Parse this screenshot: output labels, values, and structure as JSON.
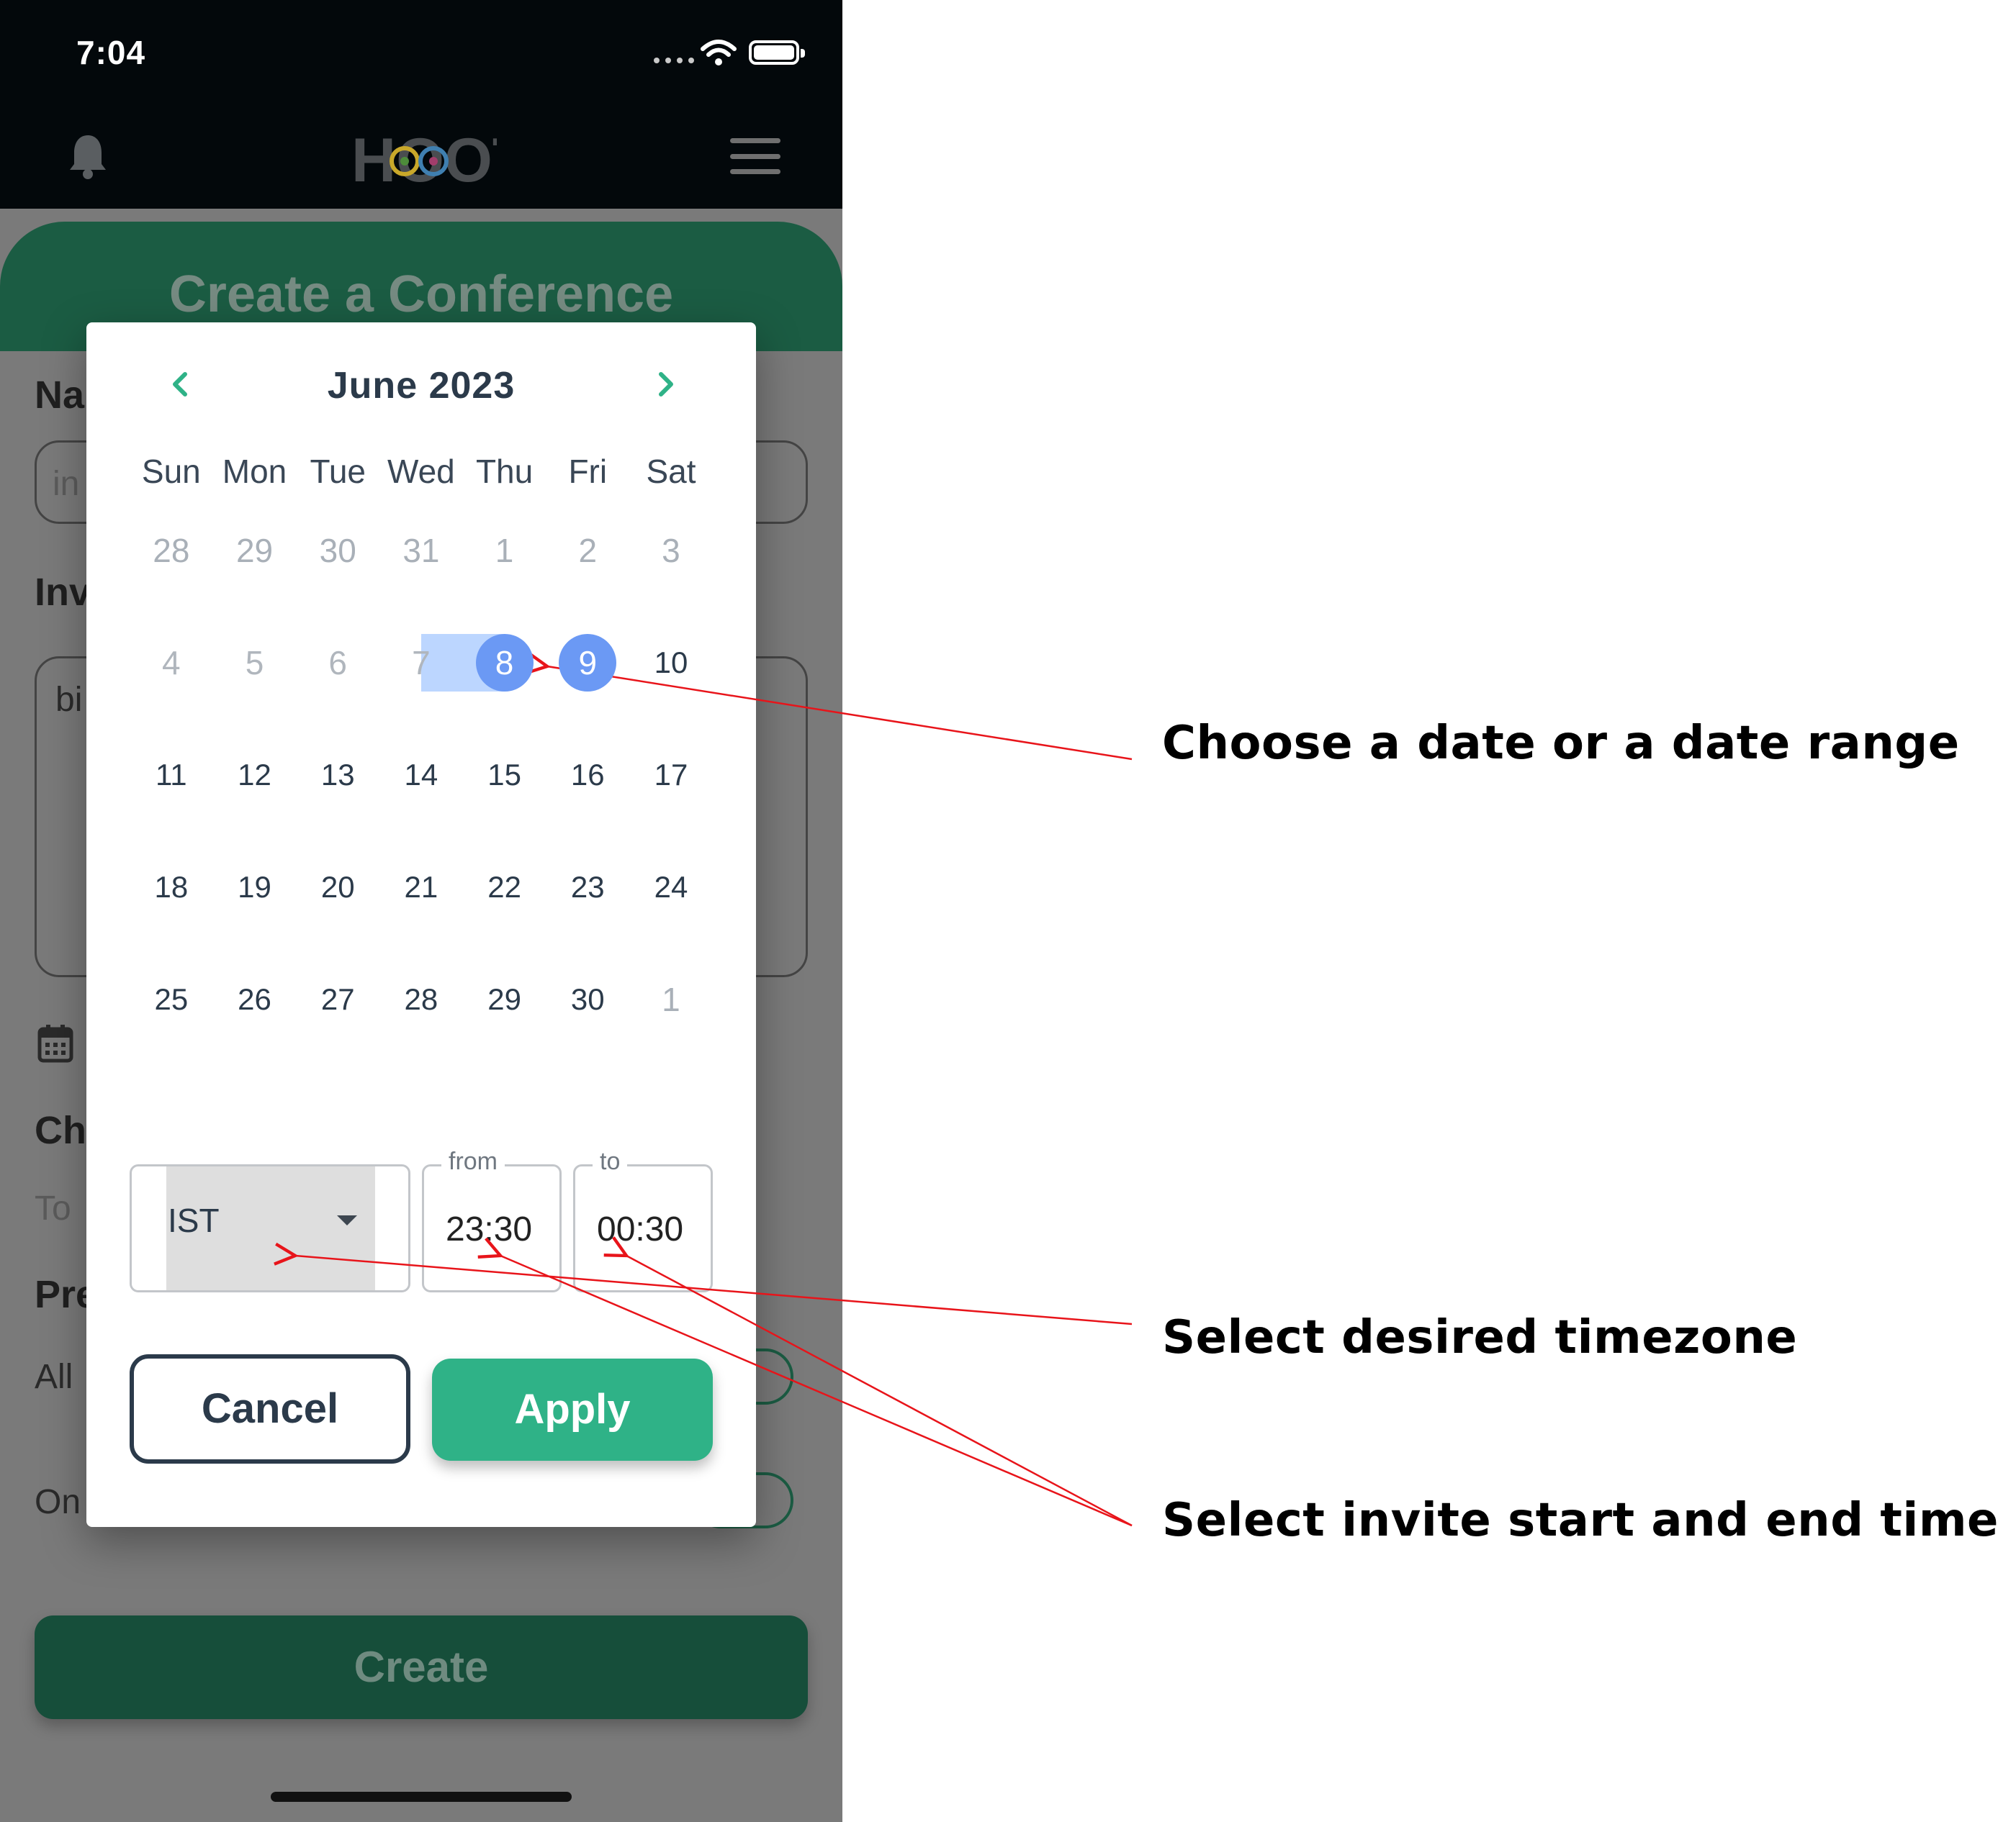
{
  "status_bar": {
    "time": "7:04"
  },
  "app_bar": {
    "logo_text": "HOOT"
  },
  "page": {
    "title": "Create a Conference"
  },
  "background_form": {
    "name_label": "Na",
    "name_value": "in",
    "invite_label": "Inv",
    "invite_value": "bi",
    "choose_label": "Ch",
    "to_label": "To",
    "pre_label": "Pre",
    "allow_label": "All",
    "only_label": "On",
    "create_label": "Create"
  },
  "date_picker": {
    "month_label": "June 2023",
    "weekdays": [
      "Sun",
      "Mon",
      "Tue",
      "Wed",
      "Thu",
      "Fri",
      "Sat"
    ],
    "weeks": [
      [
        "28",
        "29",
        "30",
        "31",
        "1",
        "2",
        "3"
      ],
      [
        "4",
        "5",
        "6",
        "7",
        "8",
        "9",
        "10"
      ],
      [
        "11",
        "12",
        "13",
        "14",
        "15",
        "16",
        "17"
      ],
      [
        "18",
        "19",
        "20",
        "21",
        "22",
        "23",
        "24"
      ],
      [
        "25",
        "26",
        "27",
        "28",
        "29",
        "30",
        "1"
      ]
    ],
    "selected_range": [
      "8",
      "9"
    ],
    "timezone": "IST",
    "from_label": "from",
    "from_value": "23:30",
    "to_label": "to",
    "to_value": "00:30",
    "cancel_label": "Cancel",
    "apply_label": "Apply"
  },
  "annotations": {
    "date": "Choose a date or a date range",
    "timezone": "Select desired timezone",
    "time": "Select invite start and end time",
    "arrow_color": "#e8141a"
  },
  "colors": {
    "primary_green": "#2fb287",
    "dark_green": "#1b5c43",
    "selected_blue": "#6b99f4",
    "range_blue": "#bcd6ff"
  }
}
